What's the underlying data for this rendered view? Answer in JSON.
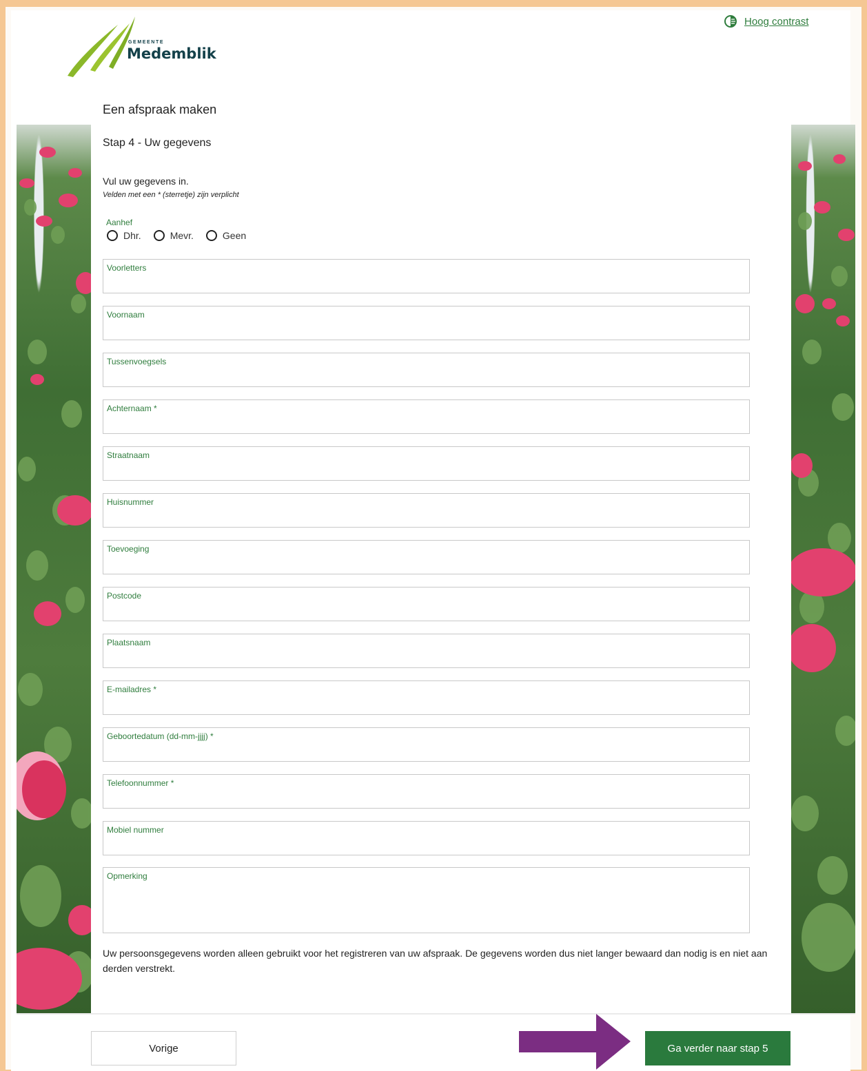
{
  "header": {
    "logo_small": "GEMEENTE",
    "logo_name": "Medemblik",
    "contrast_link": "Hoog contrast"
  },
  "page_title": "Een afspraak maken",
  "step_title": "Stap 4 - Uw gegevens",
  "intro": "Vul uw gegevens in.",
  "intro_note": "Velden met een * (sterretje) zijn verplicht",
  "aanhef": {
    "label": "Aanhef",
    "options": [
      "Dhr.",
      "Mevr.",
      "Geen"
    ]
  },
  "fields": [
    {
      "label": "Voorletters",
      "value": ""
    },
    {
      "label": "Voornaam",
      "value": ""
    },
    {
      "label": "Tussenvoegsels",
      "value": ""
    },
    {
      "label": "Achternaam *",
      "value": ""
    },
    {
      "label": "Straatnaam",
      "value": ""
    },
    {
      "label": "Huisnummer",
      "value": ""
    },
    {
      "label": "Toevoeging",
      "value": ""
    },
    {
      "label": "Postcode",
      "value": ""
    },
    {
      "label": "Plaatsnaam",
      "value": ""
    },
    {
      "label": "E-mailadres *",
      "value": ""
    },
    {
      "label": "Geboortedatum (dd-mm-jjjj) *",
      "value": ""
    },
    {
      "label": "Telefoonnummer *",
      "value": ""
    },
    {
      "label": "Mobiel nummer",
      "value": ""
    },
    {
      "label": "Opmerking",
      "value": ""
    }
  ],
  "privacy_text": "Uw persoonsgegevens worden alleen gebruikt voor het registreren van uw afspraak. De gegevens worden dus niet langer bewaard dan nodig is en niet aan derden verstrekt.",
  "buttons": {
    "prev": "Vorige",
    "next": "Ga verder naar stap 5"
  },
  "colors": {
    "accent_green": "#2a7a3d",
    "label_green": "#2f7d3d",
    "frame_border": "#f5c793",
    "annotation_arrow": "#7b2d82"
  },
  "icons": {
    "contrast": "contrast-icon",
    "annotation": "arrow-right-icon"
  }
}
